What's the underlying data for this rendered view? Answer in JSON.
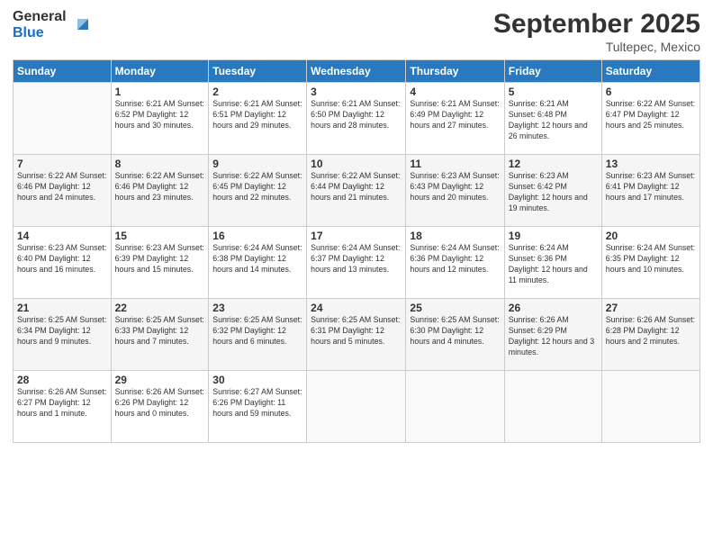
{
  "header": {
    "logo_general": "General",
    "logo_blue": "Blue",
    "month_title": "September 2025",
    "location": "Tultepec, Mexico"
  },
  "days_of_week": [
    "Sunday",
    "Monday",
    "Tuesday",
    "Wednesday",
    "Thursday",
    "Friday",
    "Saturday"
  ],
  "weeks": [
    [
      {
        "day": "",
        "info": ""
      },
      {
        "day": "1",
        "info": "Sunrise: 6:21 AM\nSunset: 6:52 PM\nDaylight: 12 hours\nand 30 minutes."
      },
      {
        "day": "2",
        "info": "Sunrise: 6:21 AM\nSunset: 6:51 PM\nDaylight: 12 hours\nand 29 minutes."
      },
      {
        "day": "3",
        "info": "Sunrise: 6:21 AM\nSunset: 6:50 PM\nDaylight: 12 hours\nand 28 minutes."
      },
      {
        "day": "4",
        "info": "Sunrise: 6:21 AM\nSunset: 6:49 PM\nDaylight: 12 hours\nand 27 minutes."
      },
      {
        "day": "5",
        "info": "Sunrise: 6:21 AM\nSunset: 6:48 PM\nDaylight: 12 hours\nand 26 minutes."
      },
      {
        "day": "6",
        "info": "Sunrise: 6:22 AM\nSunset: 6:47 PM\nDaylight: 12 hours\nand 25 minutes."
      }
    ],
    [
      {
        "day": "7",
        "info": "Sunrise: 6:22 AM\nSunset: 6:46 PM\nDaylight: 12 hours\nand 24 minutes."
      },
      {
        "day": "8",
        "info": "Sunrise: 6:22 AM\nSunset: 6:46 PM\nDaylight: 12 hours\nand 23 minutes."
      },
      {
        "day": "9",
        "info": "Sunrise: 6:22 AM\nSunset: 6:45 PM\nDaylight: 12 hours\nand 22 minutes."
      },
      {
        "day": "10",
        "info": "Sunrise: 6:22 AM\nSunset: 6:44 PM\nDaylight: 12 hours\nand 21 minutes."
      },
      {
        "day": "11",
        "info": "Sunrise: 6:23 AM\nSunset: 6:43 PM\nDaylight: 12 hours\nand 20 minutes."
      },
      {
        "day": "12",
        "info": "Sunrise: 6:23 AM\nSunset: 6:42 PM\nDaylight: 12 hours\nand 19 minutes."
      },
      {
        "day": "13",
        "info": "Sunrise: 6:23 AM\nSunset: 6:41 PM\nDaylight: 12 hours\nand 17 minutes."
      }
    ],
    [
      {
        "day": "14",
        "info": "Sunrise: 6:23 AM\nSunset: 6:40 PM\nDaylight: 12 hours\nand 16 minutes."
      },
      {
        "day": "15",
        "info": "Sunrise: 6:23 AM\nSunset: 6:39 PM\nDaylight: 12 hours\nand 15 minutes."
      },
      {
        "day": "16",
        "info": "Sunrise: 6:24 AM\nSunset: 6:38 PM\nDaylight: 12 hours\nand 14 minutes."
      },
      {
        "day": "17",
        "info": "Sunrise: 6:24 AM\nSunset: 6:37 PM\nDaylight: 12 hours\nand 13 minutes."
      },
      {
        "day": "18",
        "info": "Sunrise: 6:24 AM\nSunset: 6:36 PM\nDaylight: 12 hours\nand 12 minutes."
      },
      {
        "day": "19",
        "info": "Sunrise: 6:24 AM\nSunset: 6:36 PM\nDaylight: 12 hours\nand 11 minutes."
      },
      {
        "day": "20",
        "info": "Sunrise: 6:24 AM\nSunset: 6:35 PM\nDaylight: 12 hours\nand 10 minutes."
      }
    ],
    [
      {
        "day": "21",
        "info": "Sunrise: 6:25 AM\nSunset: 6:34 PM\nDaylight: 12 hours\nand 9 minutes."
      },
      {
        "day": "22",
        "info": "Sunrise: 6:25 AM\nSunset: 6:33 PM\nDaylight: 12 hours\nand 7 minutes."
      },
      {
        "day": "23",
        "info": "Sunrise: 6:25 AM\nSunset: 6:32 PM\nDaylight: 12 hours\nand 6 minutes."
      },
      {
        "day": "24",
        "info": "Sunrise: 6:25 AM\nSunset: 6:31 PM\nDaylight: 12 hours\nand 5 minutes."
      },
      {
        "day": "25",
        "info": "Sunrise: 6:25 AM\nSunset: 6:30 PM\nDaylight: 12 hours\nand 4 minutes."
      },
      {
        "day": "26",
        "info": "Sunrise: 6:26 AM\nSunset: 6:29 PM\nDaylight: 12 hours\nand 3 minutes."
      },
      {
        "day": "27",
        "info": "Sunrise: 6:26 AM\nSunset: 6:28 PM\nDaylight: 12 hours\nand 2 minutes."
      }
    ],
    [
      {
        "day": "28",
        "info": "Sunrise: 6:26 AM\nSunset: 6:27 PM\nDaylight: 12 hours\nand 1 minute."
      },
      {
        "day": "29",
        "info": "Sunrise: 6:26 AM\nSunset: 6:26 PM\nDaylight: 12 hours\nand 0 minutes."
      },
      {
        "day": "30",
        "info": "Sunrise: 6:27 AM\nSunset: 6:26 PM\nDaylight: 11 hours\nand 59 minutes."
      },
      {
        "day": "",
        "info": ""
      },
      {
        "day": "",
        "info": ""
      },
      {
        "day": "",
        "info": ""
      },
      {
        "day": "",
        "info": ""
      }
    ]
  ]
}
